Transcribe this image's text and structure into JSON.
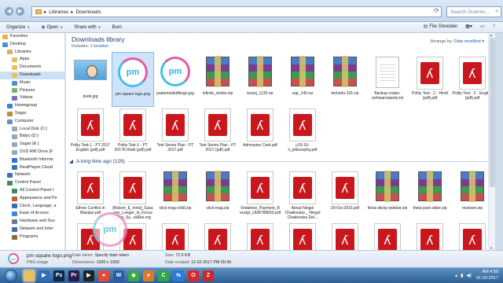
{
  "address": {
    "breadcrumb": [
      "Libraries",
      "Downloads"
    ],
    "search_placeholder": "Search Downlo..."
  },
  "toolbar": {
    "organize": "Organize",
    "open": "Open",
    "share_with": "Share with",
    "burn": "Burn",
    "file_shredder": "File Shredder"
  },
  "nav": [
    {
      "label": "Favorites",
      "level": 0,
      "icon": "star-icon",
      "color": "#e9b53f"
    },
    {
      "label": "Desktop",
      "level": 0,
      "icon": "desktop-icon",
      "color": "#4f8fd8"
    },
    {
      "label": "Libraries",
      "level": 1,
      "icon": "libraries-icon",
      "color": "#d6b35a"
    },
    {
      "label": "Apps",
      "level": 2,
      "icon": "folder-icon",
      "color": "#e8c15a"
    },
    {
      "label": "Documents",
      "level": 2,
      "icon": "documents-icon",
      "color": "#e8c15a"
    },
    {
      "label": "Downloads",
      "level": 2,
      "icon": "downloads-icon",
      "color": "#e8c15a",
      "selected": true
    },
    {
      "label": "Music",
      "level": 2,
      "icon": "music-icon",
      "color": "#4f8fd8"
    },
    {
      "label": "Pictures",
      "level": 2,
      "icon": "pictures-icon",
      "color": "#6fb86a"
    },
    {
      "label": "Videos",
      "level": 2,
      "icon": "videos-icon",
      "color": "#7b6fc5"
    },
    {
      "label": "Homegroup",
      "level": 1,
      "icon": "homegroup-icon",
      "color": "#2e8ad8"
    },
    {
      "label": "Sagar",
      "level": 1,
      "icon": "user-icon",
      "color": "#c88a3a"
    },
    {
      "label": "Computer",
      "level": 1,
      "icon": "computer-icon",
      "color": "#6a8fb8"
    },
    {
      "label": "Local Disk (C:)",
      "level": 2,
      "icon": "disk-icon",
      "color": "#9aa7b5"
    },
    {
      "label": "Bidyo (D:)",
      "level": 2,
      "icon": "disk-icon",
      "color": "#9aa7b5"
    },
    {
      "label": "Sagar (E:)",
      "level": 2,
      "icon": "disk-icon",
      "color": "#9aa7b5"
    },
    {
      "label": "DVD RW Drive (F",
      "level": 2,
      "icon": "dvd-icon",
      "color": "#9aa7b5"
    },
    {
      "label": "Bluetooth Informa",
      "level": 2,
      "icon": "bluetooth-icon",
      "color": "#2e6fd8"
    },
    {
      "label": "RealPlayer Cloud",
      "level": 2,
      "icon": "cloud-icon",
      "color": "#3a6fb8"
    },
    {
      "label": "Network",
      "level": 1,
      "icon": "network-icon",
      "color": "#3a6fb8"
    },
    {
      "label": "Control Panel",
      "level": 1,
      "icon": "control-panel-icon",
      "color": "#3a8a6a"
    },
    {
      "label": "All Control Panel I",
      "level": 2,
      "icon": "control-panel-icon",
      "color": "#3a8a6a"
    },
    {
      "label": "Appearance and Pe",
      "level": 2,
      "icon": "appearance-icon",
      "color": "#c85a3a"
    },
    {
      "label": "Clock, Language, a",
      "level": 2,
      "icon": "clock-icon",
      "color": "#3a6fb8"
    },
    {
      "label": "Ease of Access",
      "level": 2,
      "icon": "ease-access-icon",
      "color": "#3a8ad8"
    },
    {
      "label": "Hardware and Sou",
      "level": 2,
      "icon": "hardware-icon",
      "color": "#6a7a8a"
    },
    {
      "label": "Network and Inter",
      "level": 2,
      "icon": "network-icon",
      "color": "#3a6fb8"
    },
    {
      "label": "Programs",
      "level": 2,
      "icon": "programs-icon",
      "color": "#8a6a3a"
    }
  ],
  "library": {
    "title": "Downloads library",
    "includes_prefix": "Includes:",
    "includes_link": "1 location",
    "arrange_label": "Arrange by:",
    "arrange_value": "Date modified"
  },
  "recent_rows": [
    [
      {
        "name": "dude.jpg",
        "type": "jpg-dude"
      },
      {
        "name": "pm square logo.png",
        "type": "pm",
        "selected": true
      },
      {
        "name": "pastemediafblogo.jpg",
        "type": "pm"
      },
      {
        "name": "infinite_stroke.zip",
        "type": "rar"
      },
      {
        "name": "toranj_1130.rar",
        "type": "rar"
      },
      {
        "name": "zap_140.rar",
        "type": "rar"
      },
      {
        "name": "techedu-101.rar",
        "type": "rar"
      },
      {
        "name": "Backup-codes-vishwaroopedu.txt",
        "type": "txt"
      },
      {
        "name": "Polity Test - 2 - Hindi (pdf).pdf",
        "type": "pdf"
      },
      {
        "name": "Polity Test - 2 - English (pdf).pdf",
        "type": "pdf"
      }
    ],
    [
      {
        "name": "Polity Test-1 - PT 2017 English (pdf).pdf",
        "type": "pdf"
      },
      {
        "name": "Polity Test-1 - PT 20176 Hindi (pdf).pdf",
        "type": "pdf"
      },
      {
        "name": "Test Series Plan - PT 2017.pdf",
        "type": "pdf"
      },
      {
        "name": "Test Series Plan - PT 2017 (pdf).pdf",
        "type": "pdf"
      },
      {
        "name": "Admission Card.pdf",
        "type": "pdf"
      },
      {
        "name": "j-03-16-ii_philosophy.pdf",
        "type": "pdf"
      }
    ]
  ],
  "group": {
    "label": "A long time ago (129)"
  },
  "old_rows": [
    [
      {
        "name": "Ethnic Conflict in Manipur.pdf",
        "type": "pdf"
      },
      {
        "name": "[Robert_E_Innis]_Susanne_Langer_in_Focus_The_Sy...ok$ee.org",
        "type": "pdf"
      },
      {
        "name": "click-mag-child.zip",
        "type": "rar"
      },
      {
        "name": "click-mag.zip",
        "type": "rar"
      },
      {
        "name": "Vodafone_Payment_Receipt_c698789659.pdf",
        "type": "pdf"
      },
      {
        "name": "About Ningol Chakkouba _ Ningol Chakkouba Del...",
        "type": "pdf"
      },
      {
        "name": "29-Oct-2016.pdf",
        "type": "pdf"
      },
      {
        "name": "theia-sticky-sidebar.zip",
        "type": "rar"
      },
      {
        "name": "theia-post-slider.zip",
        "type": "rar"
      },
      {
        "name": "reviewer.zip",
        "type": "rar"
      }
    ],
    [
      {
        "name": "",
        "type": "pdf"
      },
      {
        "name": "",
        "type": "pdf"
      },
      {
        "name": "",
        "type": "pdf"
      },
      {
        "name": "",
        "type": "pdf"
      },
      {
        "name": "",
        "type": "pdf"
      },
      {
        "name": "",
        "type": "pdf"
      },
      {
        "name": "",
        "type": "pdf"
      },
      {
        "name": "",
        "type": "pdf"
      },
      {
        "name": "",
        "type": "pdf"
      },
      {
        "name": "",
        "type": "pdf"
      }
    ]
  ],
  "drag_ghost_text": "pm",
  "details": {
    "filename": "pm square logo.png",
    "filetype": "PNG image",
    "date_taken_label": "Date taken:",
    "date_taken_value": "Specify date taken",
    "dimensions_label": "Dimensions:",
    "dimensions_value": "1000 x 1000",
    "size_label": "Size:",
    "size_value": "72.5 KB",
    "date_created_label": "Date created:",
    "date_created_value": "11-02-2017 PM 05:49",
    "thumb_text": "pm"
  },
  "taskbar": {
    "apps": [
      {
        "name": "explorer-app-icon",
        "label": "",
        "color": "#e8c15a"
      },
      {
        "name": "media-player-app-icon",
        "label": "▶",
        "color": "#2f6fb8"
      },
      {
        "name": "photoshop-app-icon",
        "label": "Ps",
        "color": "#0a2a4a"
      },
      {
        "name": "premiere-app-icon",
        "label": "Pr",
        "color": "#2a1a4a"
      },
      {
        "name": "video-player-app-icon",
        "label": "▶",
        "color": "#222"
      },
      {
        "name": "chrome-app-icon",
        "label": "●",
        "color": "#e24a3a"
      },
      {
        "name": "word-app-icon",
        "label": "W",
        "color": "#2a5aa8"
      },
      {
        "name": "bluestacks-app-icon",
        "label": "◆",
        "color": "#3aa84a"
      },
      {
        "name": "firefox-app-icon",
        "label": "●",
        "color": "#e07a2a"
      },
      {
        "name": "camtasia-app-icon",
        "label": "C",
        "color": "#2aa84a"
      },
      {
        "name": "teamviewer-app-icon",
        "label": "⇆",
        "color": "#2a7ad8"
      },
      {
        "name": "opera-app-icon",
        "label": "O",
        "color": "#d82a2a"
      },
      {
        "name": "filezilla-app-icon",
        "label": "Z",
        "color": "#c82a2a"
      }
    ],
    "time": "AM 4:50",
    "date": "01-03-2017"
  }
}
